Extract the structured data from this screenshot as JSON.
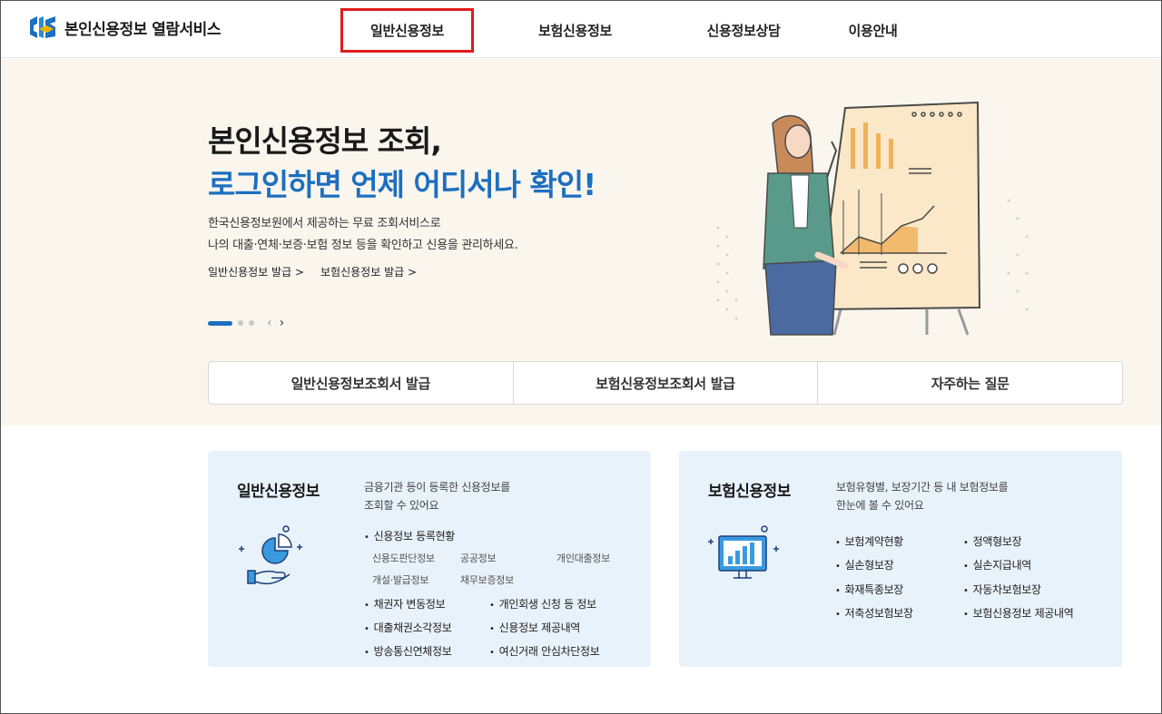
{
  "header": {
    "logo_text": "본인신용정보 열람서비스",
    "nav": [
      "일반신용정보",
      "보험신용정보",
      "신용정보상담",
      "이용안내"
    ],
    "active_nav": "일반신용정보"
  },
  "hero": {
    "title_line1": "본인신용정보 조회,",
    "title_line2": "로그인하면 언제 어디서나 확인!",
    "desc_line1": "한국신용정보원에서 제공하는 무료 조회서비스로",
    "desc_line2": "나의 대출·연체·보증·보험 정보 등을 확인하고 신용을 관리하세요.",
    "link1": "일반신용정보 발급 >",
    "link2": "보험신용정보 발급 >"
  },
  "quick_tabs": [
    "일반신용정보조회서 발급",
    "보험신용정보조회서 발급",
    "자주하는 질문"
  ],
  "general_card": {
    "title": "일반신용정보",
    "desc_line1": "금융기관 등이 등록한 신용정보를",
    "desc_line2": "조회할 수 있어요",
    "registration": "신용정보 등록현황",
    "sub_items": [
      "신용도판단정보",
      "공공정보",
      "개인대출정보",
      "개설·발급정보",
      "채무보증정보"
    ],
    "items_left": [
      "채권자 변동정보",
      "대출채권소각정보",
      "방송통신연체정보"
    ],
    "items_right": [
      "개인회생 신청 등 정보",
      "신용정보 제공내역",
      "여신거래 안심차단정보"
    ]
  },
  "insurance_card": {
    "title": "보험신용정보",
    "desc_line1": "보험유형별, 보장기간 등 내 보험정보를",
    "desc_line2": "한눈에 볼 수 있어요",
    "items_left": [
      "보험계약현황",
      "실손형보장",
      "화재특종보장",
      "저축성보험보장"
    ],
    "items_right": [
      "정액형보장",
      "실손지급내역",
      "자동차보험보장",
      "보험신용정보 제공내역"
    ]
  },
  "colors": {
    "accent_blue": "#1d6fbf",
    "hero_bg": "#faf6ee",
    "card_bg": "#e8f2fb",
    "highlight_red": "#e11b1b"
  }
}
